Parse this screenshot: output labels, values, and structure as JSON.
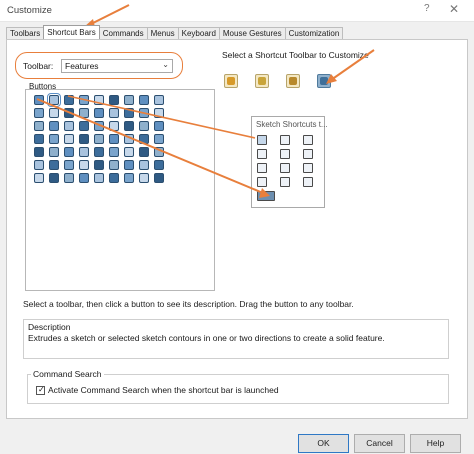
{
  "window": {
    "title": "Customize",
    "help_glyph": "?",
    "close_glyph": "✕"
  },
  "tabs": [
    {
      "label": "Toolbars",
      "active": false
    },
    {
      "label": "Shortcut Bars",
      "active": true
    },
    {
      "label": "Commands",
      "active": false
    },
    {
      "label": "Menus",
      "active": false
    },
    {
      "label": "Keyboard",
      "active": false
    },
    {
      "label": "Mouse Gestures",
      "active": false
    },
    {
      "label": "Customization",
      "active": false
    }
  ],
  "toolbar_select": {
    "label": "Toolbar:",
    "value": "Features",
    "chevron": "⌄"
  },
  "buttons_section": {
    "label": "Buttons"
  },
  "shortcut_bar_picker": {
    "label": "Select a Shortcut Toolbar to Customize",
    "buttons": [
      {
        "icon": "part-shortcut-icon",
        "active": false
      },
      {
        "icon": "assembly-shortcut-icon",
        "active": false
      },
      {
        "icon": "drawing-shortcut-icon",
        "active": false
      },
      {
        "icon": "sketch-shortcut-icon",
        "active": true
      }
    ]
  },
  "sketch_popup": {
    "title": "Sketch Shortcuts t..."
  },
  "status_line": "Select a toolbar, then click a button to see its description. Drag the button to any toolbar.",
  "description": {
    "title": "Description",
    "text": "Extrudes a sketch or selected sketch contours in one or two directions to create a solid feature."
  },
  "command_search": {
    "title": "Command Search",
    "checkbox_label": "Activate Command Search when the shortcut bar is launched",
    "checked": true,
    "tick": "✓"
  },
  "dialog_buttons": {
    "ok": "OK",
    "cancel": "Cancel",
    "help": "Help"
  },
  "colors": {
    "annotation": "#e87f3c",
    "accent": "#2f78c5"
  }
}
